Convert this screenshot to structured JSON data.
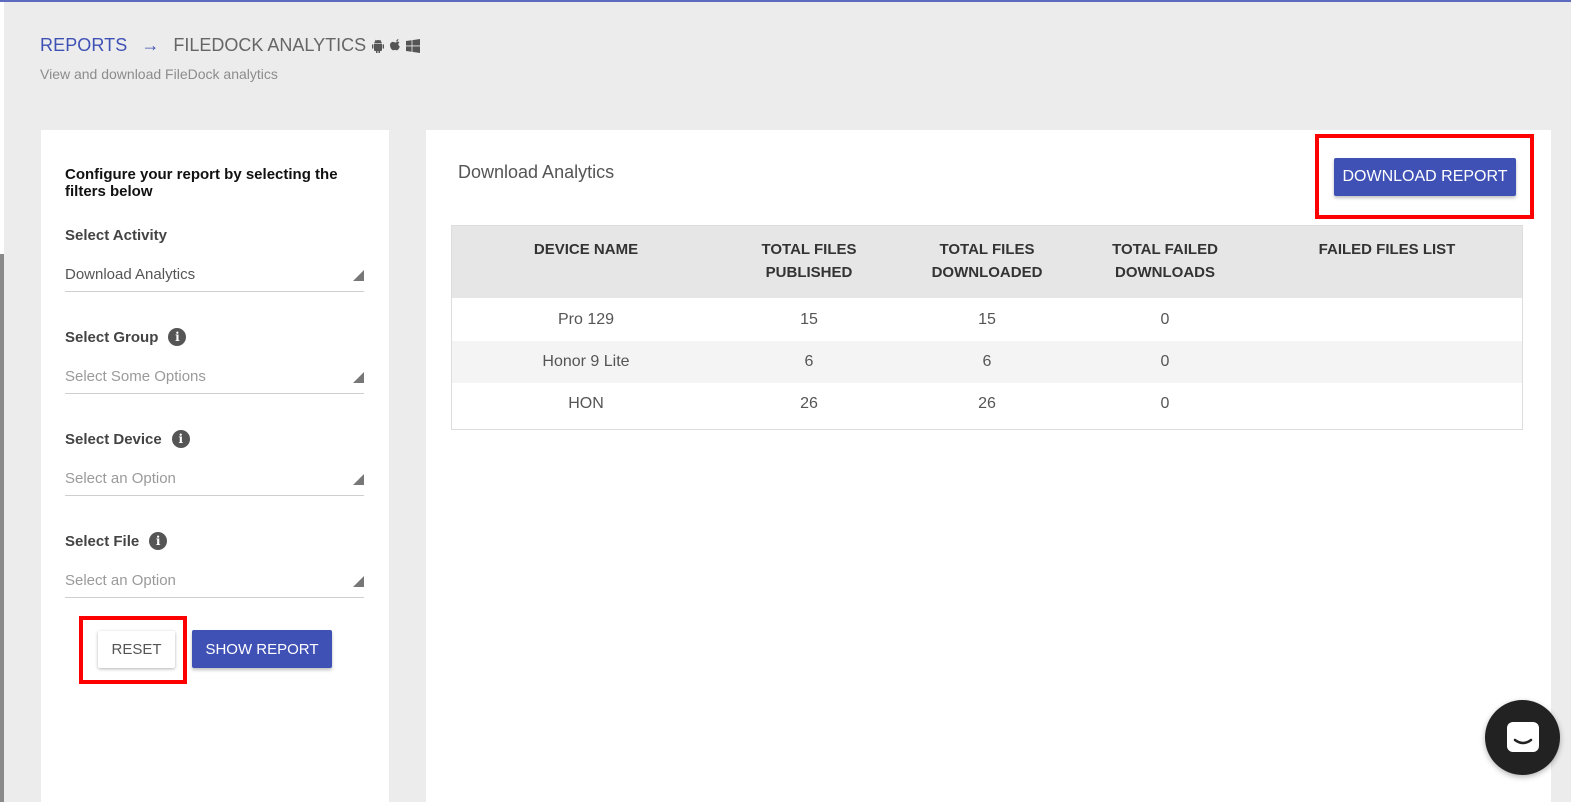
{
  "breadcrumb": {
    "parent": "REPORTS",
    "arrow": "→",
    "current": "FILEDOCK ANALYTICS",
    "os_icons": [
      "android-icon",
      "apple-icon",
      "windows-icon"
    ]
  },
  "subtitle": "View and download FileDock analytics",
  "filters": {
    "intro": "Configure your report by selecting the filters below",
    "activity": {
      "label": "Select Activity",
      "value": "Download Analytics"
    },
    "group": {
      "label": "Select Group",
      "placeholder": "Select Some Options"
    },
    "device": {
      "label": "Select Device",
      "placeholder": "Select an Option"
    },
    "file": {
      "label": "Select File",
      "placeholder": "Select an Option"
    },
    "reset_label": "RESET",
    "show_label": "SHOW REPORT"
  },
  "report": {
    "title": "Download Analytics",
    "download_label": "DOWNLOAD REPORT",
    "columns": [
      "DEVICE NAME",
      "TOTAL FILES PUBLISHED",
      "TOTAL FILES DOWNLOADED",
      "TOTAL FAILED DOWNLOADS",
      "FAILED FILES LIST"
    ],
    "columns_lines": [
      [
        "DEVICE NAME",
        ""
      ],
      [
        "TOTAL FILES",
        "PUBLISHED"
      ],
      [
        "TOTAL FILES",
        "DOWNLOADED"
      ],
      [
        "TOTAL FAILED",
        "DOWNLOADS"
      ],
      [
        "FAILED FILES LIST",
        ""
      ]
    ],
    "rows": [
      {
        "device": "Pro 129",
        "published": "15",
        "downloaded": "15",
        "failed": "0",
        "failed_list": ""
      },
      {
        "device": "Honor 9 Lite",
        "published": "6",
        "downloaded": "6",
        "failed": "0",
        "failed_list": ""
      },
      {
        "device": "HON",
        "published": "26",
        "downloaded": "26",
        "failed": "0",
        "failed_list": ""
      }
    ]
  },
  "colors": {
    "primary": "#3f51b5",
    "highlight": "#ff0000",
    "background": "#ececec"
  },
  "chat_icon": "chat-icon"
}
